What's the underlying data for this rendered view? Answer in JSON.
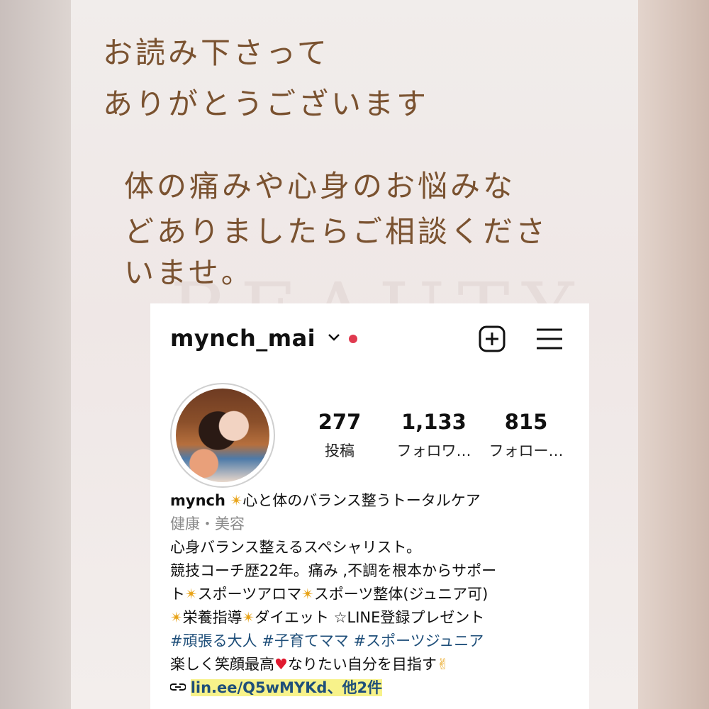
{
  "message": {
    "line1": "お読み下さって",
    "line2": "ありがとうございます",
    "line3": "体の痛みや心身のお悩みな",
    "line4": "どありましたらご相談くださ",
    "line5": "いませ。"
  },
  "watermark": "BEAUTY",
  "profile": {
    "username": "mynch_mai",
    "stats": [
      {
        "value": "277",
        "label": "投稿"
      },
      {
        "value": "1,133",
        "label": "フォロワ…"
      },
      {
        "value": "815",
        "label": "フォロー…"
      }
    ],
    "bio": {
      "name": "mynch",
      "name_suffix": "心と体のバランス整うトータルケア",
      "category": "健康・美容",
      "line1": "心身バランス整えるスペシャリスト。",
      "line2": "競技コーチ歴22年。痛み ,不調を根本からサポー",
      "line3a": "ト",
      "line3b": "スポーツアロマ",
      "line3c": "スポーツ整体(ジュニア可)",
      "line4a": "栄養指導",
      "line4b": "ダイエット ☆LINE登録プレゼント",
      "hashtags": "#頑張る大人 #子育てママ #スポーツジュニア",
      "line6a": "楽しく笑顔最高",
      "line6b": "なりたい自分を目指す",
      "link": "lin.ee/Q5wMYKd、他2件"
    },
    "icons": {
      "sparkle": "✴",
      "heart": "♥",
      "victory": "✌",
      "link": "link-icon"
    }
  }
}
